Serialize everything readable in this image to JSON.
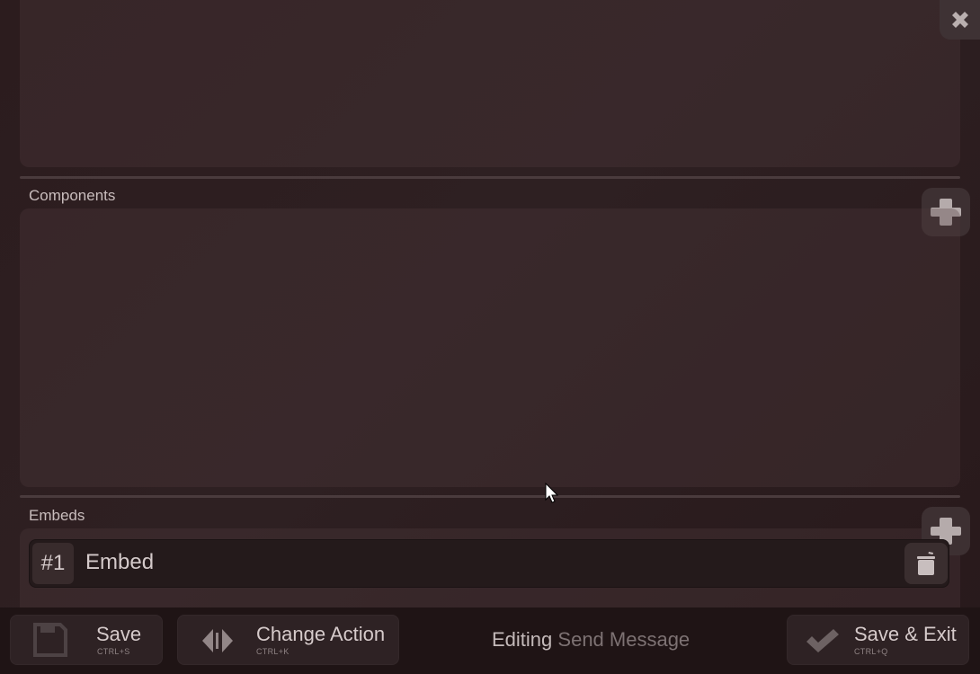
{
  "sections": {
    "components_label": "Components",
    "embeds_label": "Embeds"
  },
  "embed": {
    "number": "#1",
    "title": "Embed"
  },
  "footer": {
    "save_label": "Save",
    "save_shortcut": "CTRL+S",
    "change_action_label": "Change Action",
    "change_action_shortcut": "CTRL+K",
    "editing_prefix": "Editing",
    "editing_target": "Send Message",
    "save_exit_label": "Save & Exit",
    "save_exit_shortcut": "CTRL+Q"
  },
  "icons": {
    "close": "close-icon",
    "add_component": "plus-icon",
    "add_embed": "plus-icon",
    "delete_embed": "trash-icon",
    "save": "floppy-disk-icon",
    "change_action": "arrows-left-right-icon",
    "save_exit": "checkmark-icon"
  },
  "colors": {
    "background": "#2c1c1e",
    "panel": "#3a2a2c",
    "text": "#d6cbcb",
    "muted": "#7d7273"
  }
}
